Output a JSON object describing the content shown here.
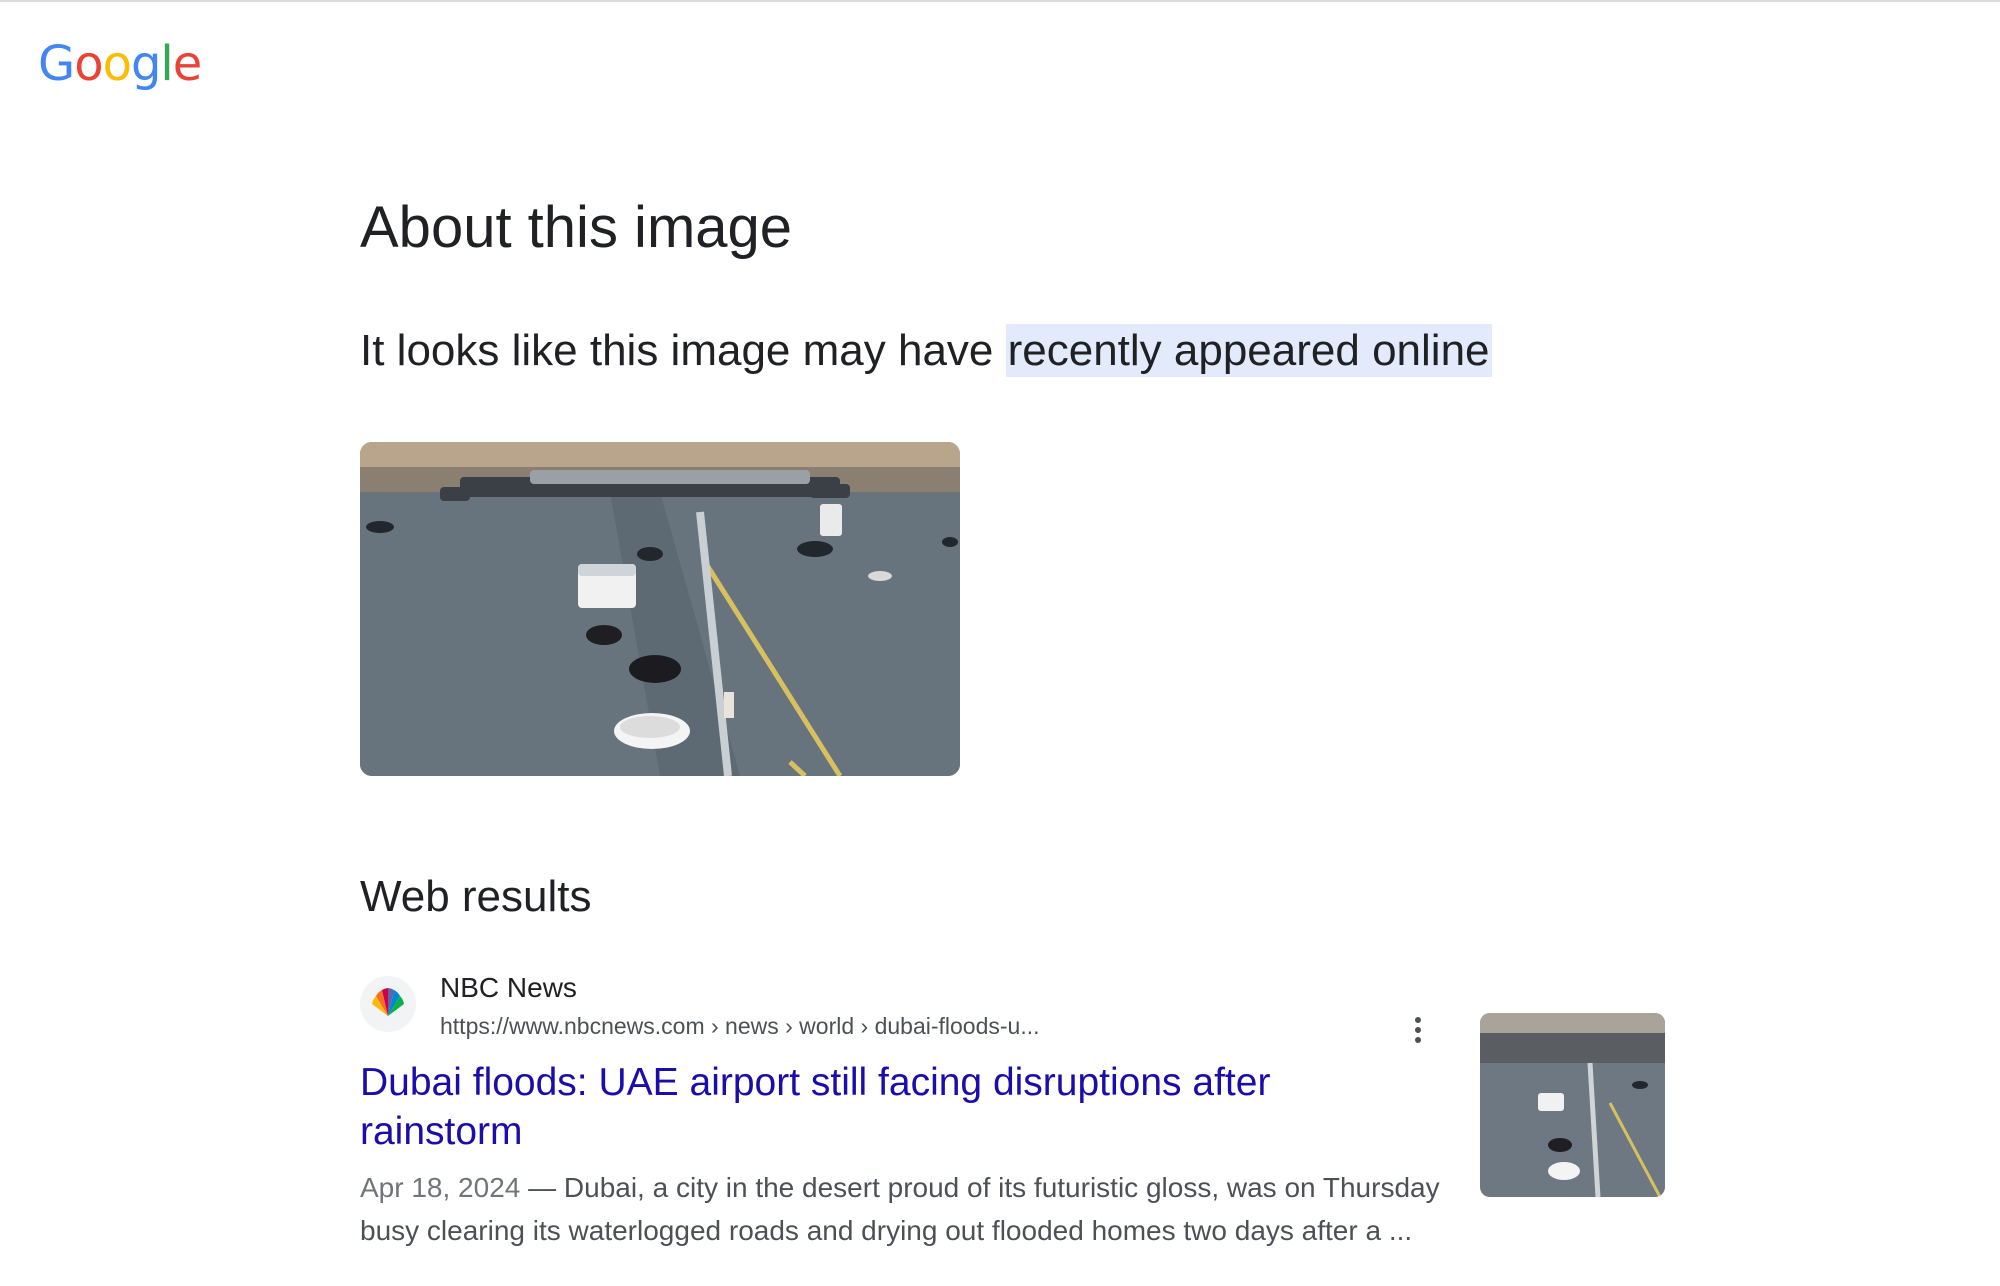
{
  "brand": {
    "logo_letters": [
      "G",
      "o",
      "o",
      "g",
      "l",
      "e"
    ],
    "logo_colors": [
      "#4285F4",
      "#EA4335",
      "#FBBC05",
      "#4285F4",
      "#34A853",
      "#EA4335"
    ]
  },
  "about": {
    "heading": "About this image",
    "subtitle_prefix": "It looks like this image may have ",
    "subtitle_highlight": "recently appeared online"
  },
  "web_results": {
    "heading": "Web results",
    "items": [
      {
        "site_name": "NBC News",
        "url": "https://www.nbcnews.com › news › world › dubai-floods-u...",
        "title": "Dubai floods: UAE airport still facing disruptions after rainstorm",
        "date": "Apr 18, 2024",
        "snippet": " — Dubai, a city in the desert proud of its futuristic gloss, was on Thursday busy clearing its waterlogged roads and drying out flooded homes two days after a ..."
      }
    ]
  },
  "colors": {
    "link": "#1a0dab",
    "highlight_bg": "#e2eafc",
    "text": "#202124",
    "secondary_text": "#4d5156"
  },
  "icons": {
    "site_icon": "nbc-peacock-icon",
    "more": "more-vert-icon"
  }
}
